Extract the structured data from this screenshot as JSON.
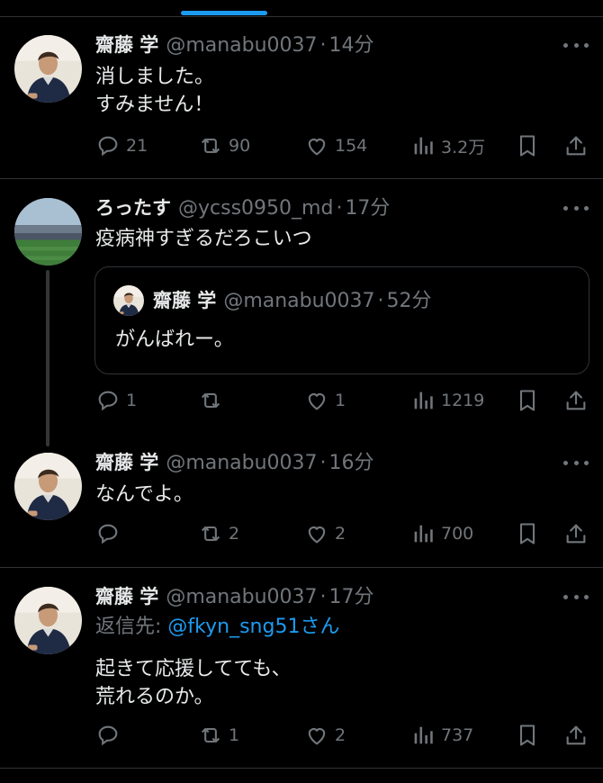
{
  "colors": {
    "accent": "#1d9bf0",
    "muted": "#71767b",
    "text": "#e7e9ea",
    "divider": "#2f3336"
  },
  "posts": [
    {
      "name": "齋藤 学",
      "handle": "@manabu0037",
      "time": "14分",
      "text": "消しました。\nすみません！",
      "replies": "21",
      "reposts": "90",
      "likes": "154",
      "views": "3.2万"
    },
    {
      "name": "ろったす",
      "handle": "@ycss0950_md",
      "time": "17分",
      "text": "疫病神すぎるだろこいつ",
      "quote": {
        "name": "齋藤 学",
        "handle": "@manabu0037",
        "time": "52分",
        "text": "がんばれー。"
      },
      "replies": "1",
      "reposts": "",
      "likes": "1",
      "views": "1219"
    },
    {
      "name": "齋藤 学",
      "handle": "@manabu0037",
      "time": "16分",
      "text": "なんでよ。",
      "replies": "",
      "reposts": "2",
      "likes": "2",
      "views": "700"
    },
    {
      "name": "齋藤 学",
      "handle": "@manabu0037",
      "time": "17分",
      "reply_to_label": "返信先: ",
      "reply_to_mention": "@fkyn_sng51",
      "reply_to_suffix": "さん",
      "text": "起きて応援してても、\n荒れるのか。",
      "replies": "",
      "reposts": "1",
      "likes": "2",
      "views": "737"
    }
  ],
  "icons": [
    "reply-icon",
    "repost-icon",
    "like-icon",
    "views-icon",
    "bookmark-icon",
    "share-icon",
    "more-icon"
  ]
}
